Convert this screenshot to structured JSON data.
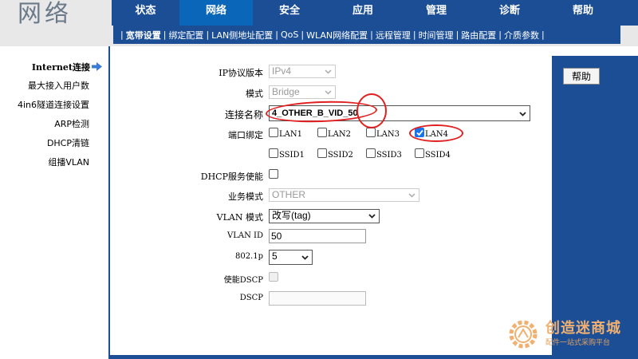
{
  "header": {
    "logo_text": "网络",
    "tabs": [
      {
        "label": "状态",
        "active": false
      },
      {
        "label": "网络",
        "active": true
      },
      {
        "label": "安全",
        "active": false
      },
      {
        "label": "应用",
        "active": false
      },
      {
        "label": "管理",
        "active": false
      },
      {
        "label": "诊断",
        "active": false
      },
      {
        "label": "帮助",
        "active": false
      }
    ],
    "subtabs": [
      {
        "label": "宽带设置",
        "active": true
      },
      {
        "label": "绑定配置"
      },
      {
        "label": "LAN侧地址配置"
      },
      {
        "label": "QoS"
      },
      {
        "label": "WLAN网络配置"
      },
      {
        "label": "远程管理"
      },
      {
        "label": "时间管理"
      },
      {
        "label": "路由配置"
      },
      {
        "label": "介质参数"
      }
    ]
  },
  "sidebar": {
    "items": [
      {
        "label": "Internet连接",
        "active": true
      },
      {
        "label": "最大接入用户数"
      },
      {
        "label": "4in6隧道连接设置"
      },
      {
        "label": "ARP检测"
      },
      {
        "label": "DHCP清链"
      },
      {
        "label": "组播VLAN"
      }
    ]
  },
  "form": {
    "ip_protocol": {
      "label": "IP协议版本",
      "value": "IPv4"
    },
    "mode": {
      "label": "模式",
      "value": "Bridge"
    },
    "connection_name": {
      "label": "连接名称",
      "value": "4_OTHER_B_VID_50"
    },
    "port_binding": {
      "label": "端口绑定",
      "ports": [
        {
          "label": "LAN1",
          "checked": false
        },
        {
          "label": "LAN2",
          "checked": false
        },
        {
          "label": "LAN3",
          "checked": false
        },
        {
          "label": "LAN4",
          "checked": true
        },
        {
          "label": "SSID1",
          "checked": false
        },
        {
          "label": "SSID2",
          "checked": false
        },
        {
          "label": "SSID3",
          "checked": false
        },
        {
          "label": "SSID4",
          "checked": false
        }
      ]
    },
    "dhcp_enable": {
      "label": "DHCP服务使能",
      "checked": false
    },
    "service_mode": {
      "label": "业务模式",
      "value": "OTHER"
    },
    "vlan_mode": {
      "label": "VLAN 模式",
      "value": "改写(tag)"
    },
    "vlan_id": {
      "label": "VLAN ID",
      "value": "50"
    },
    "dot1p": {
      "label": "802.1p",
      "value": "5"
    },
    "dscp_enable": {
      "label": "使能DSCP",
      "checked": false
    },
    "dscp": {
      "label": "DSCP",
      "value": ""
    }
  },
  "help_button": "帮助",
  "watermark": {
    "title": "创造迷商城",
    "subtitle": "配件一站式采购平台"
  },
  "colors": {
    "nav_blue": "#1c4e96",
    "active_tab": "#0a66b8",
    "annotation_red": "#e02020"
  }
}
